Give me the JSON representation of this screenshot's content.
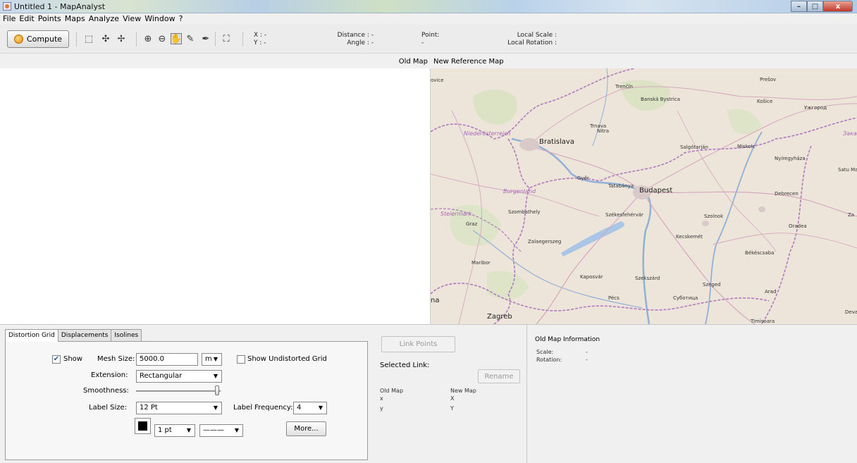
{
  "window": {
    "title": "Untitled 1 - MapAnalyst",
    "minimize": "–",
    "maximize": "□",
    "close": "x"
  },
  "menu": [
    "File",
    "Edit",
    "Points",
    "Maps",
    "Analyze",
    "View",
    "Window",
    "?"
  ],
  "toolbar": {
    "compute_label": "Compute",
    "x_readout": "X : -",
    "y_readout": "Y : -",
    "distance_readout": "Distance : -",
    "angle_readout": "Angle : -",
    "point_label": "Point:",
    "point_value": "-",
    "local_scale": "Local Scale :",
    "local_rotation": "Local Rotation :"
  },
  "maps": {
    "old_map_label": "Old Map",
    "new_map_label": "New Reference Map",
    "cities": {
      "trencin": "Trenčín",
      "banska": "Banská Bystrica",
      "presov": "Prešov",
      "kosice": "Košice",
      "uzhhorod": "Ужгород",
      "zaka": "Зака",
      "niederosterreich": "Niederösterreich",
      "trnava": "Trnava",
      "nitra": "Nitra",
      "bratislava": "Bratislava",
      "salgotarjan": "Salgótarján",
      "miskolc": "Miskolc",
      "nyiregyhaza": "Nyíregyháza",
      "satu_mare": "Satu Mar",
      "gyor": "Győr",
      "tatabanya": "Tatabánya",
      "budapest": "Budapest",
      "burgenland": "Burgenland",
      "debrecen": "Debrecen",
      "steiermark": "Steiermark",
      "szombathely": "Szombathely",
      "szekesfehervar": "Székesfehérvár",
      "szolnok": "Szolnok",
      "graz": "Graz",
      "oradea": "Oradea",
      "za": "Za",
      "zalaegerszeg": "Zalaegerszeg",
      "kecskemet": "Kecskemét",
      "bekescsaba": "Békéscsaba",
      "maribor": "Maribor",
      "kaposvar": "Kaposvár",
      "szekszard": "Szekszárd",
      "szeged": "Szeged",
      "arad": "Arad",
      "pecs": "Pécs",
      "subotica": "Суботица",
      "deva": "Deva",
      "zagreb": "Zagreb",
      "timisoara": "Timișoara",
      "na": "na",
      "dvice": "ovice"
    }
  },
  "distortion_panel": {
    "tabs": [
      "Distortion Grid",
      "Displacements",
      "Isolines"
    ],
    "show_label": "Show",
    "show_checked": true,
    "mesh_size_label": "Mesh Size:",
    "mesh_size_value": "5000.0",
    "mesh_unit": "m",
    "show_undistorted_label": "Show Undistorted Grid",
    "show_undistorted_checked": false,
    "extension_label": "Extension:",
    "extension_value": "Rectangular",
    "smoothness_label": "Smoothness:",
    "smoothness_value": 1.0,
    "label_size_label": "Label Size:",
    "label_size_value": "12 Pt",
    "label_frequency_label": "Label Frequency:",
    "label_frequency_value": "4",
    "line_width_value": "1 pt",
    "line_style_value": "———",
    "more_label": "More...",
    "line_color": "#000000"
  },
  "link_panel": {
    "link_points_label": "Link Points",
    "selected_link_label": "Selected Link:",
    "rename_label": "Rename",
    "old_map_col": "Old Map",
    "new_map_col": "New Map",
    "old_x": "x",
    "old_y": "y",
    "new_x": "X",
    "new_y": "Y"
  },
  "info_panel": {
    "title": "Old Map Information",
    "scale_label": "Scale:",
    "scale_value": "-",
    "rotation_label": "Rotation:",
    "rotation_value": "-"
  },
  "colors": {
    "map_land": "#ede5d9",
    "border_purple": "#b07ac0",
    "road": "#c9a4b8",
    "river": "#8fb1d8",
    "forest": "#cfe2b4"
  }
}
